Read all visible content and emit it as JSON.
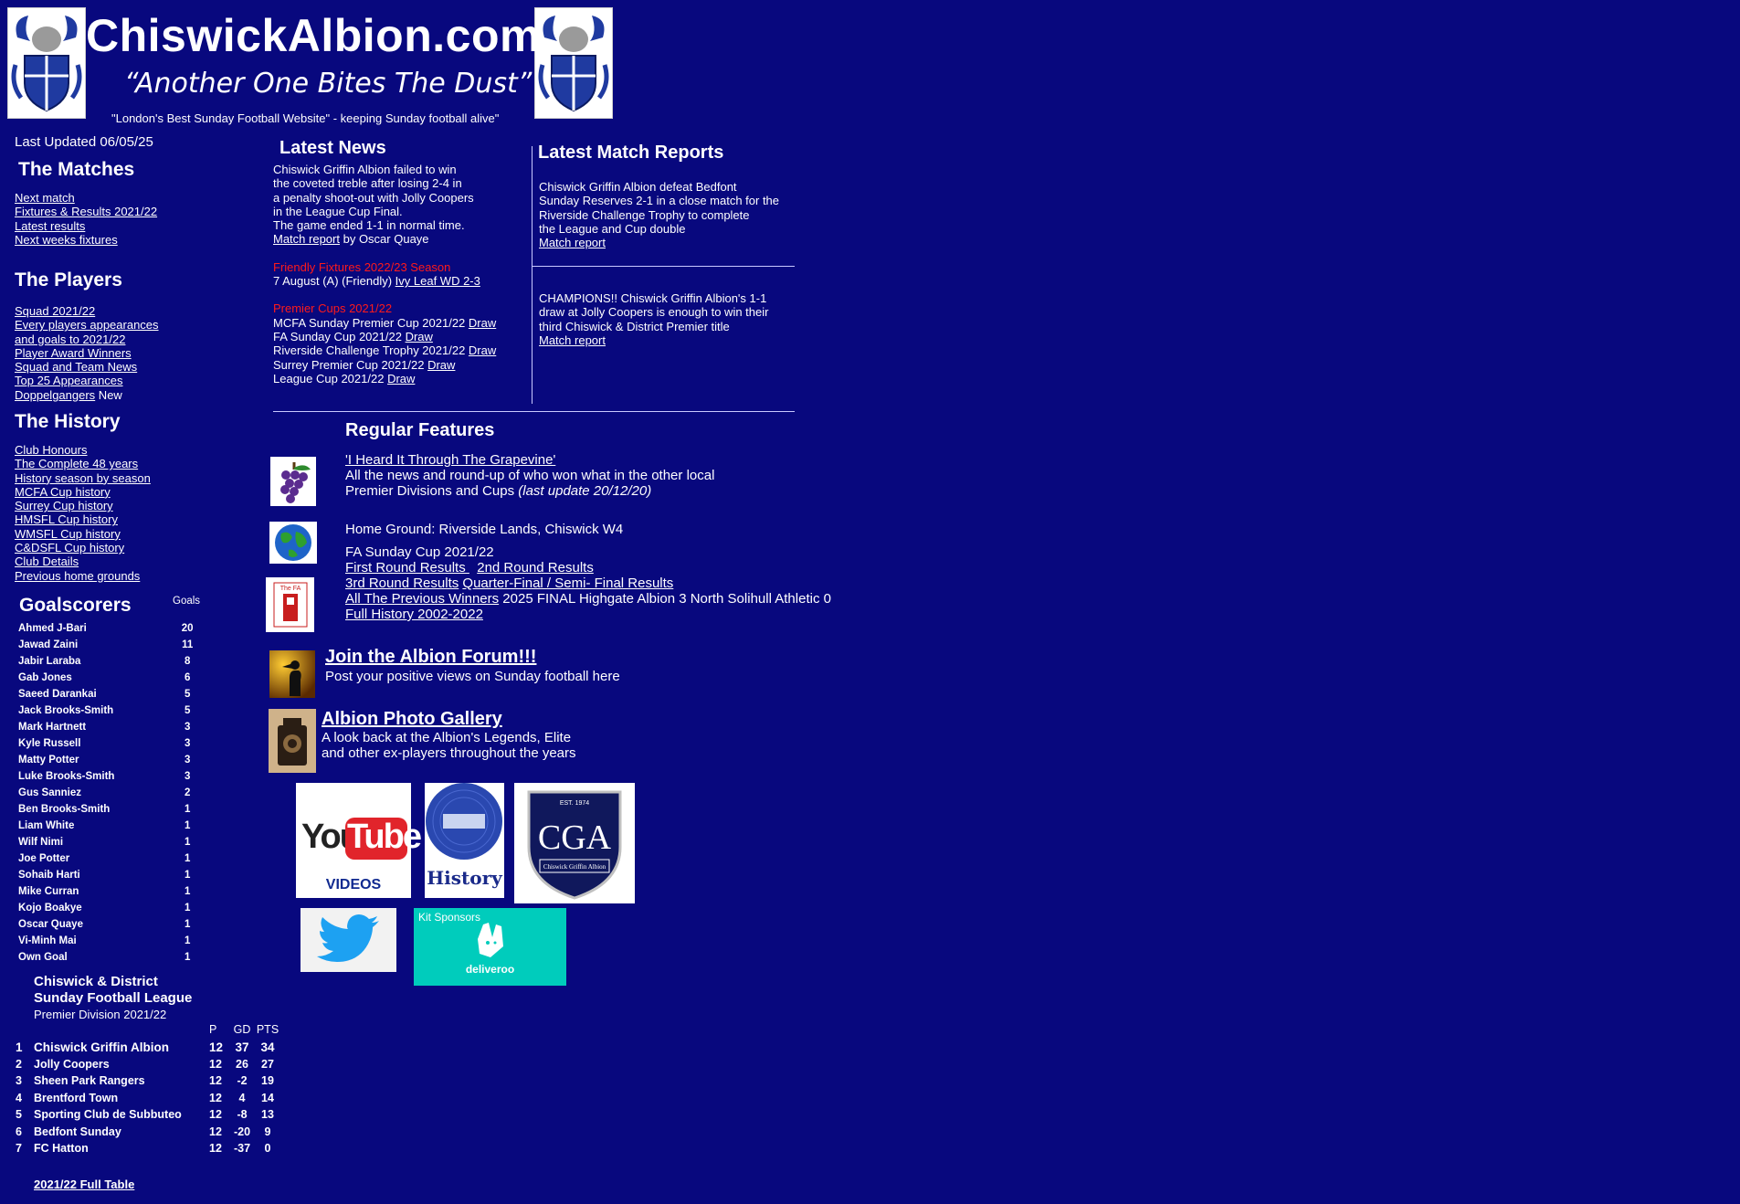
{
  "header": {
    "title": "ChiswickAlbion.com",
    "motto": "“Another One Bites The Dust”",
    "tagline": "\"London's Best Sunday Football Website\" - keeping Sunday football alive\""
  },
  "sidebar": {
    "last_updated": "Last Updated 06/05/25",
    "matches_heading": "The Matches",
    "matches_links": [
      "Next match",
      "Fixtures & Results 2021/22",
      "Latest results",
      "Next weeks fixtures"
    ],
    "players_heading": "The Players",
    "players_links": [
      "Squad 2021/22",
      "Every players appearances",
      "and goals to 2021/22",
      "Player Award Winners",
      "Squad and Team News",
      "Top 25 Appearances"
    ],
    "doppel_link": "Doppelgangers",
    "doppel_new": " New",
    "history_heading": "The History",
    "history_links": [
      "Club Honours",
      "The Complete 48 years",
      "History season by season",
      "MCFA Cup history",
      "Surrey Cup history",
      "HMSFL Cup history",
      "WMSFL Cup history",
      "C&DSFL Cup history",
      "Club Details",
      "Previous home grounds"
    ],
    "goalscorers_heading": "Goalscorers",
    "goals_label": "Goals",
    "scorers": [
      {
        "name": "Ahmed J-Bari",
        "goals": "20"
      },
      {
        "name": "Jawad Zaini",
        "goals": "11"
      },
      {
        "name": "Jabir Laraba",
        "goals": "8"
      },
      {
        "name": "Gab Jones",
        "goals": "6"
      },
      {
        "name": "Saeed Darankai",
        "goals": "5"
      },
      {
        "name": "Jack Brooks-Smith",
        "goals": "5"
      },
      {
        "name": "Mark Hartnett",
        "goals": "3"
      },
      {
        "name": "Kyle Russell",
        "goals": "3"
      },
      {
        "name": "Matty Potter",
        "goals": "3"
      },
      {
        "name": "Luke Brooks-Smith",
        "goals": "3"
      },
      {
        "name": "Gus Sanniez",
        "goals": "2"
      },
      {
        "name": "Ben Brooks-Smith",
        "goals": "1"
      },
      {
        "name": "Liam White",
        "goals": "1"
      },
      {
        "name": "Wilf Nimi",
        "goals": "1"
      },
      {
        "name": "Joe Potter",
        "goals": "1"
      },
      {
        "name": "Sohaib Harti",
        "goals": "1"
      },
      {
        "name": "Mike Curran",
        "goals": "1"
      },
      {
        "name": "Kojo Boakye",
        "goals": "1"
      },
      {
        "name": "Oscar Quaye",
        "goals": "1"
      },
      {
        "name": "Vi-Minh Mai",
        "goals": "1"
      },
      {
        "name": "Own Goal",
        "goals": "1"
      }
    ],
    "league_title_1": "Chiswick & District",
    "league_title_2": "Sunday Football League",
    "league_subtitle": "Premier Division 2021/22",
    "league_cols": {
      "p": "P",
      "gd": "GD",
      "pts": "PTS"
    },
    "league_rows": [
      {
        "pos": "1",
        "team": "Chiswick Griffin Albion",
        "p": "12",
        "gd": "37",
        "pts": "34"
      },
      {
        "pos": "2",
        "team": "Jolly Coopers",
        "p": "12",
        "gd": "26",
        "pts": "27"
      },
      {
        "pos": "3",
        "team": "Sheen Park Rangers",
        "p": "12",
        "gd": "-2",
        "pts": "19"
      },
      {
        "pos": "4",
        "team": "Brentford Town",
        "p": "12",
        "gd": "4",
        "pts": "14"
      },
      {
        "pos": "5",
        "team": "Sporting Club de Subbuteo",
        "p": "12",
        "gd": "-8",
        "pts": "13"
      },
      {
        "pos": "6",
        "team": "Bedfont Sunday",
        "p": "12",
        "gd": "-20",
        "pts": "9"
      },
      {
        "pos": "7",
        "team": "FC Hatton",
        "p": "12",
        "gd": "-37",
        "pts": "0"
      }
    ],
    "full_table_link": "2021/22 Full Table"
  },
  "news": {
    "heading": "Latest News",
    "lines": [
      "Chiswick Griffin Albion failed to win",
      "the coveted treble after losing 2-4 in",
      "a penalty shoot-out with Jolly Coopers",
      "in the League Cup Final.",
      "The game ended 1-1 in normal time."
    ],
    "report_link": "Match report",
    "report_by": " by Oscar Quaye",
    "friendly_heading": "Friendly Fixtures 2022/23 Season",
    "friendly_text": "7 August (A) (Friendly) ",
    "friendly_link": "Ivy Leaf WD 2-3",
    "cups_heading": "Premier Cups 2021/22",
    "cups": [
      {
        "text": "MCFA Sunday Premier Cup 2021/22 ",
        "link": "Draw"
      },
      {
        "text": "FA Sunday Cup 2021/22 ",
        "link": "Draw"
      },
      {
        "text": "Riverside Challenge Trophy 2021/22 ",
        "link": "Draw"
      },
      {
        "text": "Surrey Premier Cup 2021/22 ",
        "link": "Draw"
      },
      {
        "text": "League Cup 2021/22 ",
        "link": "Draw"
      }
    ]
  },
  "reports": {
    "heading": "Latest Match Reports",
    "report1": [
      "Chiswick Griffin Albion defeat Bedfont",
      "Sunday Reserves 2-1 in a close match for the",
      "Riverside Challenge Trophy to complete",
      "the League and Cup double"
    ],
    "report1_link": "Match report",
    "report2": [
      "CHAMPIONS!! Chiswick Griffin Albion's 1-1",
      "draw at Jolly Coopers is enough to win their",
      "third Chiswick & District Premier title"
    ],
    "report2_link": "Match report"
  },
  "features": {
    "heading": "Regular Features",
    "grapevine_link": "'I Heard It Through The Grapevine'",
    "grapevine_text_1": "All the news and round-up of who won what in the other local",
    "grapevine_text_2": "Premier Divisions and Cups ",
    "grapevine_update": "(last update 20/12/20)",
    "home_ground": "Home Ground: Riverside Lands, Chiswick W4",
    "fa_title": "FA Sunday Cup 2021/22",
    "fa_links_1": [
      "First Round Results ",
      "2nd Round Results"
    ],
    "fa_links_2": [
      "3rd Round Results",
      "Quarter-Final / Semi- Final Results"
    ],
    "fa_prev_link": "All The Previous Winners",
    "fa_final": " 2025 FINAL Highgate Albion 3 North Solihull Athletic 0",
    "fa_history_link": "Full History 2002-2022",
    "fa_logo_text": "The FA",
    "forum_link": "Join the Albion Forum!!!",
    "forum_text": "Post your positive views on Sunday football here",
    "gallery_link": "Albion Photo Gallery",
    "gallery_text_1": "A look back at the Albion's Legends, Elite",
    "gallery_text_2": "and other ex-players throughout the years"
  },
  "tiles": {
    "youtube_word1": "You",
    "youtube_word2": "Tube",
    "youtube_caption": "VIDEOS",
    "history_caption": "History",
    "cga_text": "CGA",
    "cga_est": "EST. 1974",
    "cga_name": "Chiswick Griffin Albion",
    "kit_label": "Kit Sponsors",
    "deliveroo": "deliveroo"
  },
  "colors": {
    "background": "#08087e",
    "red_heading": "#ff1a1a",
    "youtube_red": "#e1242b",
    "twitter_blue": "#1da1f2",
    "deliveroo_teal": "#00ccbc"
  }
}
